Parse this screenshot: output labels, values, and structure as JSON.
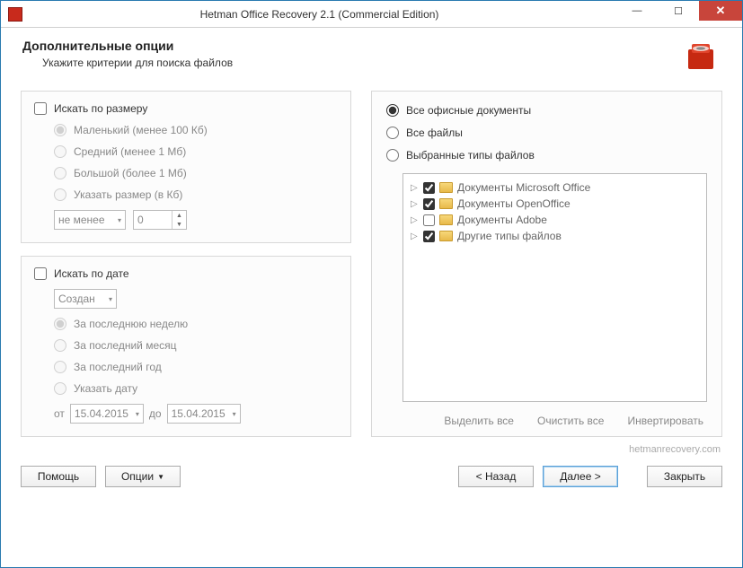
{
  "window": {
    "title": "Hetman Office Recovery 2.1 (Commercial Edition)"
  },
  "header": {
    "title": "Дополнительные опции",
    "subtitle": "Укажите критерии для поиска файлов"
  },
  "size_panel": {
    "checkbox_label": "Искать по размеру",
    "opt_small": "Маленький (менее 100 Кб)",
    "opt_medium": "Средний (менее 1 Мб)",
    "opt_large": "Большой (более 1 Мб)",
    "opt_custom": "Указать размер (в Кб)",
    "cond_select": "не менее",
    "cond_value": "0"
  },
  "date_panel": {
    "checkbox_label": "Искать по дате",
    "mode_select": "Создан",
    "opt_week": "За последнюю неделю",
    "opt_month": "За последний месяц",
    "opt_year": "За последний год",
    "opt_custom": "Указать дату",
    "from_label": "от",
    "from_value": "15.04.2015",
    "to_label": "до",
    "to_value": "15.04.2015"
  },
  "types_panel": {
    "opt_all_office": "Все офисные документы",
    "opt_all_files": "Все файлы",
    "opt_selected": "Выбранные типы файлов",
    "tree": [
      {
        "label": "Документы Microsoft Office",
        "checked": true
      },
      {
        "label": "Документы OpenOffice",
        "checked": true
      },
      {
        "label": "Документы Adobe",
        "checked": false
      },
      {
        "label": "Другие типы файлов",
        "checked": true
      }
    ],
    "link_select_all": "Выделить все",
    "link_clear_all": "Очистить все",
    "link_invert": "Инвертировать"
  },
  "brand": "hetmanrecovery.com",
  "footer": {
    "help": "Помощь",
    "options": "Опции",
    "back": "< Назад",
    "next": "Далее >",
    "close": "Закрыть"
  }
}
